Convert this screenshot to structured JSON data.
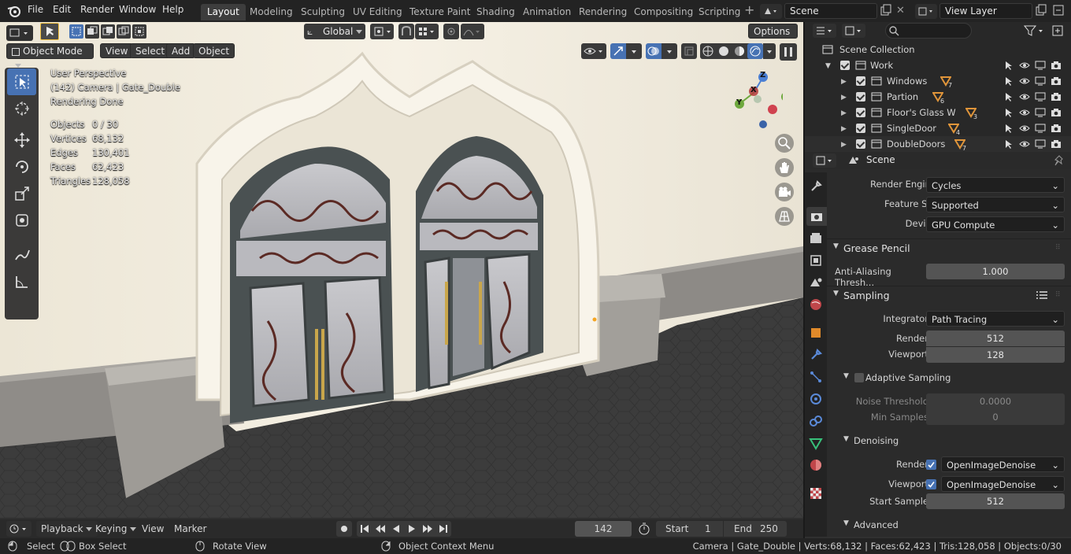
{
  "menus": [
    "File",
    "Edit",
    "Render",
    "Window",
    "Help"
  ],
  "workspaces": [
    "Layout",
    "Modeling",
    "Sculpting",
    "UV Editing",
    "Texture Paint",
    "Shading",
    "Animation",
    "Rendering",
    "Compositing",
    "Scripting"
  ],
  "active_workspace": "Layout",
  "scene_name": "Scene",
  "view_layer": "View Layer",
  "header": {
    "transform_orientation": "Global",
    "options": "Options"
  },
  "viewport": {
    "mode": "Object Mode",
    "menus": [
      "View",
      "Select",
      "Add",
      "Object"
    ],
    "overlay": {
      "perspective": "User Perspective",
      "camera_line": "(142) Camera | Gate_Double",
      "render_status": "Rendering Done",
      "stats": [
        {
          "label": "Objects",
          "value": "0 / 30"
        },
        {
          "label": "Vertices",
          "value": "68,132"
        },
        {
          "label": "Edges",
          "value": "130,401"
        },
        {
          "label": "Faces",
          "value": "62,423"
        },
        {
          "label": "Triangles",
          "value": "128,058"
        }
      ]
    },
    "gizmo": {
      "z": "Z",
      "y": "Y",
      "x": "X"
    }
  },
  "outliner": {
    "root": "Scene Collection",
    "collection": "Work",
    "children": [
      {
        "name": "Windows",
        "count": "7"
      },
      {
        "name": "Partion",
        "count": "6"
      },
      {
        "name": "Floor's Glass W",
        "count": "3"
      },
      {
        "name": "SingleDoor",
        "count": "4"
      },
      {
        "name": "DoubleDoors",
        "count": "7"
      }
    ]
  },
  "properties": {
    "context": "Scene",
    "render_engine": {
      "label": "Render Engine",
      "value": "Cycles"
    },
    "feature_set": {
      "label": "Feature Set",
      "value": "Supported"
    },
    "device": {
      "label": "Device",
      "value": "GPU Compute"
    },
    "grease_pencil": {
      "title": "Grease Pencil",
      "aa_label": "Anti-Aliasing Thresh...",
      "aa_value": "1.000"
    },
    "sampling": {
      "title": "Sampling",
      "integrator_label": "Integrator",
      "integrator": "Path Tracing",
      "render_label": "Render",
      "render": "512",
      "viewport_label": "Viewport",
      "viewport": "128",
      "adaptive": "Adaptive Sampling",
      "noise_label": "Noise Threshold",
      "noise": "0.0000",
      "min_label": "Min Samples",
      "min": "0"
    },
    "denoising": {
      "title": "Denoising",
      "render_label": "Render",
      "render": "OpenImageDenoise",
      "viewport_label": "Viewport",
      "viewport": "OpenImageDenoise",
      "start_label": "Start Sample",
      "start": "512"
    },
    "advanced": "Advanced"
  },
  "timeline": {
    "menus": [
      "Playback",
      "Keying",
      "View",
      "Marker"
    ],
    "current_frame": "142",
    "start_label": "Start",
    "start": "1",
    "end_label": "End",
    "end": "250"
  },
  "status": {
    "select": "Select",
    "box_select": "Box Select",
    "rotate": "Rotate View",
    "context_menu": "Object Context Menu",
    "info": "Camera | Gate_Double | Verts:68,132 | Faces:62,423 | Tris:128,058 | Objects:0/30"
  },
  "colors": {
    "accent": "#4772b3",
    "header": "#232323",
    "panel": "#2b2b2b",
    "wall": "#f1ebdc",
    "floor": "#3e3e3e"
  }
}
